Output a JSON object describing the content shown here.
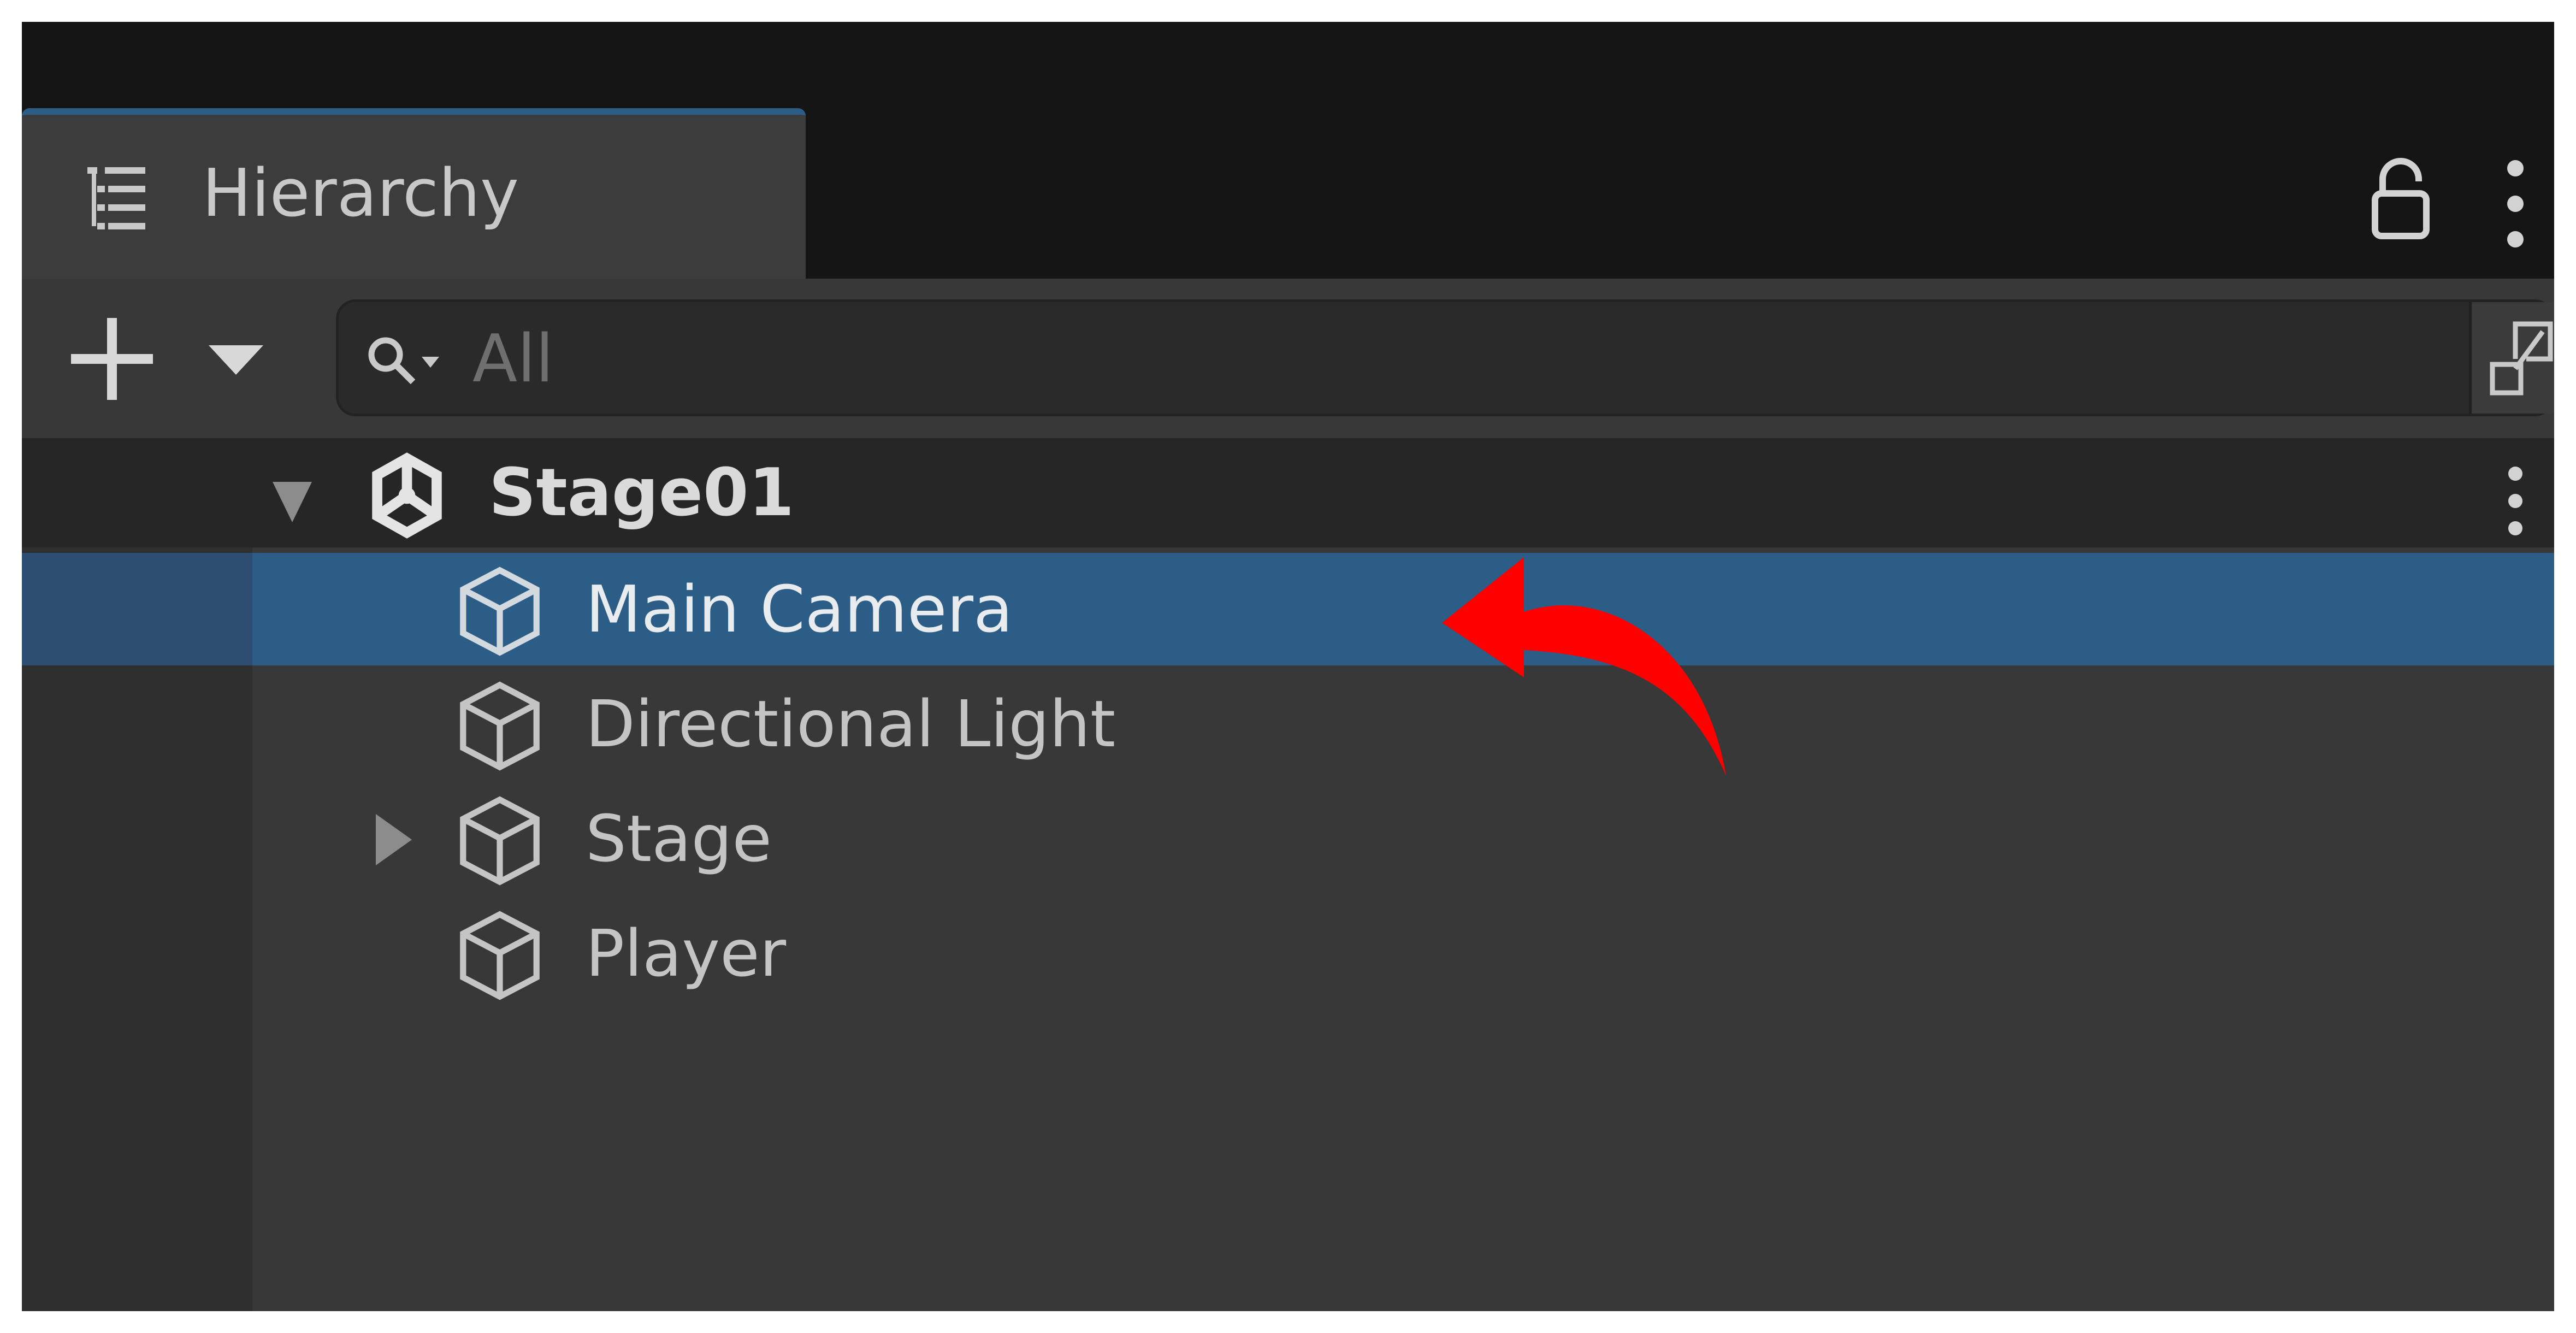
{
  "window": {
    "panel_title": "Hierarchy",
    "tab_icon": "hierarchy-list-icon",
    "lock_icon": "lock-icon",
    "menu_icon": "kebab-menu-icon"
  },
  "toolbar": {
    "add_icon": "plus-icon",
    "dropdown_icon": "caret-down-icon",
    "search_placeholder": "All",
    "search_icon": "search-icon",
    "expand_icon": "expand-icon"
  },
  "hierarchy": {
    "scene": {
      "label": "Stage01",
      "icon": "unity-scene-icon",
      "expanded": true
    },
    "items": [
      {
        "label": "Main Camera",
        "icon": "cube-icon",
        "selected": true,
        "has_children": false
      },
      {
        "label": "Directional Light",
        "icon": "cube-icon",
        "selected": false,
        "has_children": false
      },
      {
        "label": "Stage",
        "icon": "cube-icon",
        "selected": false,
        "has_children": true,
        "expanded": false
      },
      {
        "label": "Player",
        "icon": "cube-icon",
        "selected": false,
        "has_children": false
      }
    ]
  },
  "annotation": {
    "type": "arrow",
    "color": "#ff0000",
    "points_to": "Main Camera"
  },
  "colors": {
    "selection": "#2c5d87",
    "tab_accent": "#2c5d87",
    "panel_bg": "#383838",
    "title_bar": "#151515"
  }
}
